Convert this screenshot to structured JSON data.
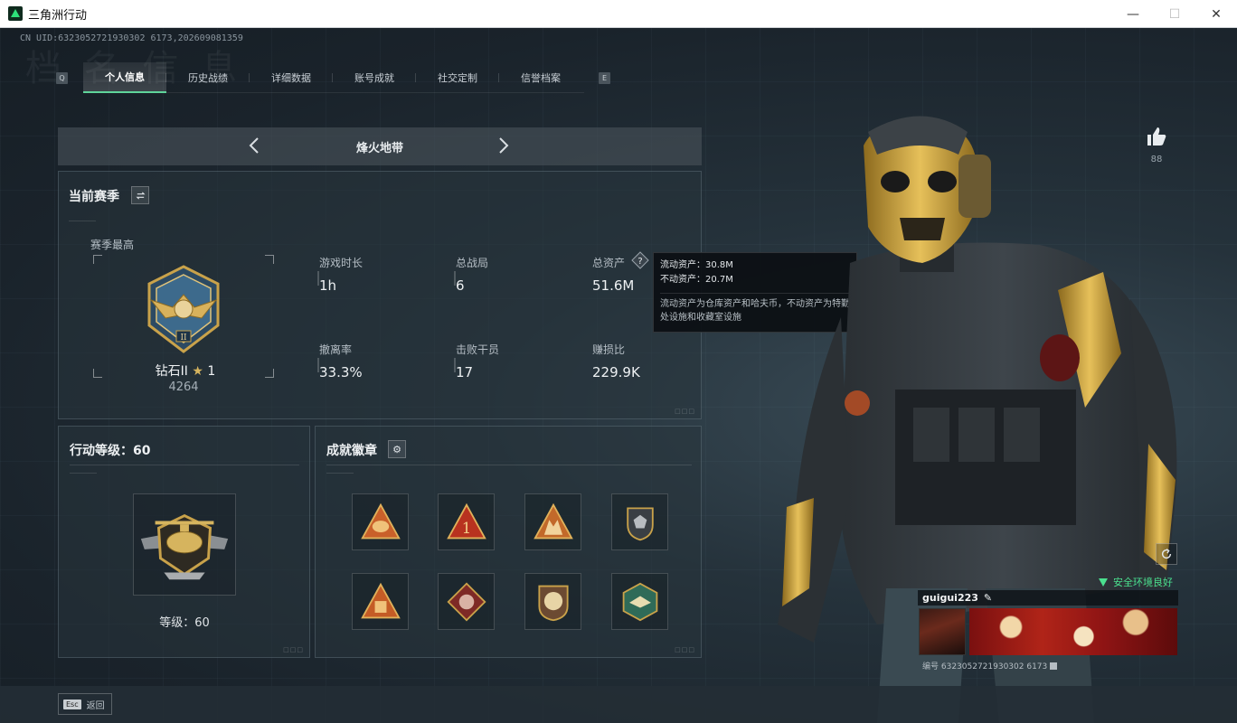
{
  "window": {
    "title": "三角洲行动",
    "minimize": "—",
    "maximize": "☐",
    "close": "✕"
  },
  "header": {
    "uid_line": "CN UID:6323052721930302 6173,202609081359",
    "watermark": "档 名 信 息"
  },
  "tabs": {
    "left_key": "Q",
    "right_key": "E",
    "items": [
      {
        "label": "个人信息",
        "active": true
      },
      {
        "label": "历史战绩",
        "active": false
      },
      {
        "label": "详细数据",
        "active": false
      },
      {
        "label": "账号成就",
        "active": false
      },
      {
        "label": "社交定制",
        "active": false
      },
      {
        "label": "信誉档案",
        "active": false
      }
    ]
  },
  "mode": {
    "title": "烽火地带"
  },
  "season": {
    "title": "当前赛季",
    "best_label": "赛季最高",
    "rank_name": "钻石II",
    "rank_stars": "1",
    "rank_score": "4264",
    "stats": [
      {
        "label": "游戏时长",
        "value": "1h"
      },
      {
        "label": "总战局",
        "value": "6"
      },
      {
        "label": "总资产",
        "value": "51.6M"
      },
      {
        "label": "撤离率",
        "value": "33.3%"
      },
      {
        "label": "击败干员",
        "value": "17"
      },
      {
        "label": "赚损比",
        "value": "229.9K"
      }
    ]
  },
  "tooltip": {
    "liquid": "流动资产：30.8M",
    "fixed": "不动资产：20.7M",
    "desc": "流动资产为仓库资产和哈夫币，不动资产为特勤处设施和收藏室设施"
  },
  "level": {
    "title": "行动等级：60",
    "text": "等级：60"
  },
  "achievements": {
    "title": "成就徽章",
    "badges": [
      {
        "name": "badge-1",
        "color": "#c9602a"
      },
      {
        "name": "badge-2",
        "color": "#b8321f"
      },
      {
        "name": "badge-3",
        "color": "#c2692a"
      },
      {
        "name": "badge-4",
        "color": "#3a3f44"
      },
      {
        "name": "badge-5",
        "color": "#c45c26"
      },
      {
        "name": "badge-6",
        "color": "#7e2a26"
      },
      {
        "name": "badge-7",
        "color": "#6c4a32"
      },
      {
        "name": "badge-8",
        "color": "#2f6b58"
      }
    ]
  },
  "social": {
    "likes": "88",
    "safe_env": "安全环境良好",
    "player_name": "guigui223",
    "player_uid": "编号 6323052721930302 6173"
  },
  "bottom": {
    "esc_key": "Esc",
    "back_label": "返回"
  },
  "colors": {
    "accent_green": "#4be08f",
    "gold": "#c9a24a"
  }
}
